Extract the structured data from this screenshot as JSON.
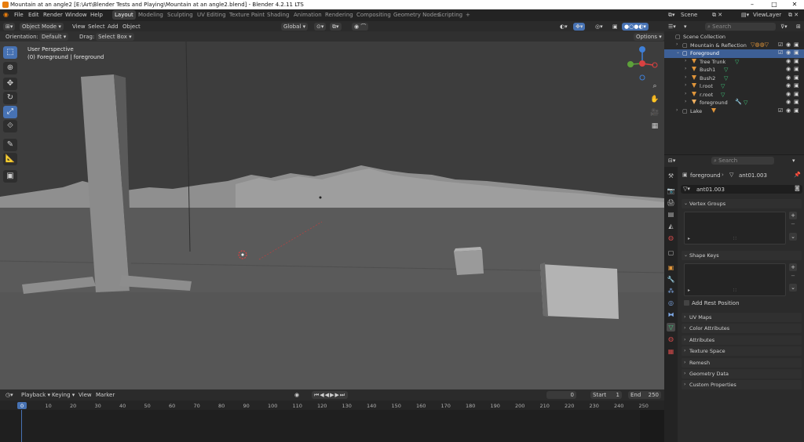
{
  "window": {
    "title": "Mountain at an angle2 [E:\\Art\\Blender Tests and Playing\\Mountain at an angle2.blend] - Blender 4.2.11 LTS",
    "minimize": "–",
    "maximize": "□",
    "close": "✕"
  },
  "menu": [
    "File",
    "Edit",
    "Render",
    "Window",
    "Help"
  ],
  "workspaces": [
    "Layout",
    "Modeling",
    "Sculpting",
    "UV Editing",
    "Texture Paint",
    "Shading",
    "Animation",
    "Rendering",
    "Compositing",
    "Geometry Nodes",
    "Scripting",
    "+"
  ],
  "viewport_header": {
    "mode": "Object Mode",
    "menus": [
      "View",
      "Select",
      "Add",
      "Object"
    ],
    "transform": "Global",
    "orientation_label": "Orientation:",
    "orientation_value": "Default",
    "drag_label": "Drag:",
    "drag_value": "Select Box",
    "options": "Options"
  },
  "viewport": {
    "perspective": "User Perspective",
    "collection": "(0) Foreground | foreground"
  },
  "outliner": {
    "scene_label": "Scene",
    "view_layer_label": "ViewLayer",
    "search_placeholder": "Search",
    "items": [
      {
        "label": "Scene Collection",
        "indent": 0
      },
      {
        "label": "Mountain & Reflection",
        "indent": 1
      },
      {
        "label": "Foreground",
        "indent": 1,
        "selected": true
      },
      {
        "label": "Tree Trunk",
        "indent": 2
      },
      {
        "label": "Bush1",
        "indent": 2
      },
      {
        "label": "Bush2",
        "indent": 2
      },
      {
        "label": "l.root",
        "indent": 2
      },
      {
        "label": "r.root",
        "indent": 2
      },
      {
        "label": "foreground",
        "indent": 2
      },
      {
        "label": "Lake",
        "indent": 1
      }
    ]
  },
  "properties": {
    "search_placeholder": "Search",
    "breadcrumb_object": "foreground",
    "breadcrumb_data": "ant01.003",
    "datablock": "ant01.003",
    "vertex_groups": "Vertex Groups",
    "shape_keys": "Shape Keys",
    "add_rest_position": "Add Rest Position",
    "panels": [
      "UV Maps",
      "Color Attributes",
      "Attributes",
      "Texture Space",
      "Remesh",
      "Geometry Data",
      "Custom Properties"
    ]
  },
  "timeline": {
    "menus": [
      "Playback",
      "Keying",
      "View",
      "Marker"
    ],
    "current_frame": "0",
    "start_label": "Start",
    "start": "1",
    "end_label": "End",
    "end": "250",
    "ticks": [
      "0",
      "10",
      "20",
      "30",
      "40",
      "50",
      "60",
      "70",
      "80",
      "90",
      "100",
      "110",
      "120",
      "130",
      "140",
      "150",
      "160",
      "170",
      "180",
      "190",
      "200",
      "210",
      "220",
      "230",
      "240",
      "250"
    ]
  }
}
